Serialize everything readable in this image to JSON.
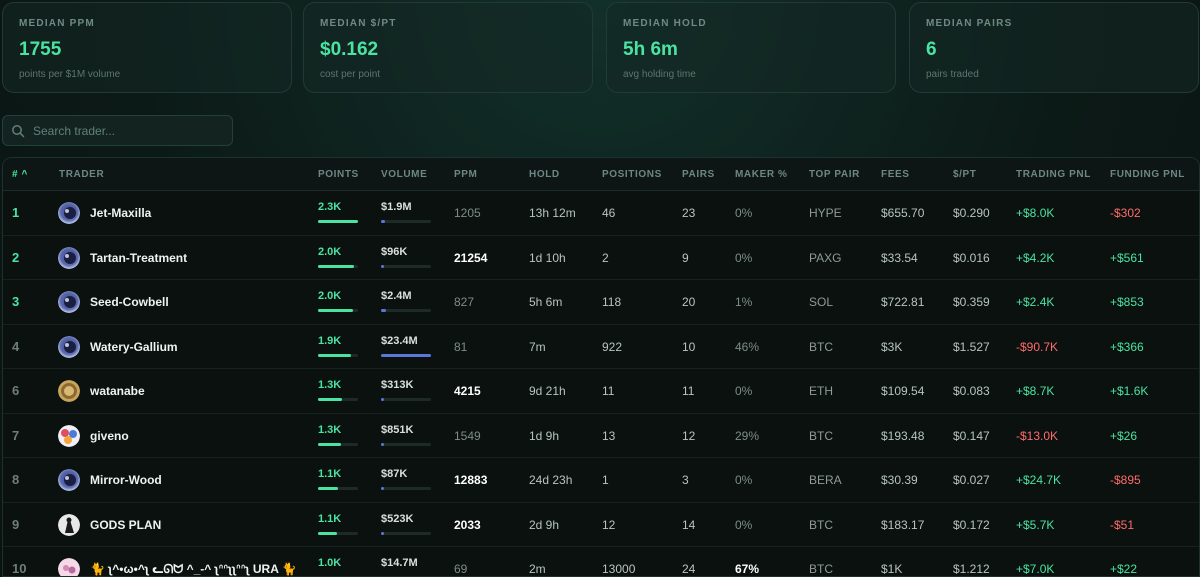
{
  "stats": [
    {
      "label": "MEDIAN PPM",
      "value": "1755",
      "sub": "points per $1M volume"
    },
    {
      "label": "MEDIAN $/PT",
      "value": "$0.162",
      "sub": "cost per point"
    },
    {
      "label": "MEDIAN HOLD",
      "value": "5h 6m",
      "sub": "avg holding time"
    },
    {
      "label": "MEDIAN PAIRS",
      "value": "6",
      "sub": "pairs traded"
    }
  ],
  "search": {
    "placeholder": "Search trader..."
  },
  "columns": {
    "rank": "# ^",
    "trader": "TRADER",
    "points": "POINTS",
    "volume": "VOLUME",
    "ppm": "PPM",
    "hold": "HOLD",
    "positions": "POSITIONS",
    "pairs": "PAIRS",
    "maker": "MAKER %",
    "top_pair": "TOP PAIR",
    "fees": "FEES",
    "per_pt": "$/PT",
    "trading_pnl": "TRADING PNL",
    "funding_pnl": "FUNDING PNL"
  },
  "colors": {
    "accent": "#4be3a2",
    "negative": "#ff6b6b",
    "volume_bar": "#5c78d6"
  },
  "rows": [
    {
      "rank": "1",
      "rank_dim": false,
      "avatar": "eclipse-avatar",
      "name": "Jet-Maxilla",
      "points": "2.3K",
      "points_fill": 1.0,
      "volume": "$1.9M",
      "volume_fill": 0.08,
      "ppm": "1205",
      "ppm_hi": false,
      "hold": "13h 12m",
      "positions": "46",
      "pairs": "23",
      "maker": "0%",
      "maker_hi": false,
      "top_pair": "HYPE",
      "fees": "$655.70",
      "per_pt": "$0.290",
      "trading_pnl": "+$8.0K",
      "trading_pos": true,
      "funding_pnl": "-$302",
      "funding_pos": false
    },
    {
      "rank": "2",
      "rank_dim": false,
      "avatar": "eclipse-avatar",
      "name": "Tartan-Treatment",
      "points": "2.0K",
      "points_fill": 0.9,
      "volume": "$96K",
      "volume_fill": 0.01,
      "ppm": "21254",
      "ppm_hi": true,
      "hold": "1d 10h",
      "positions": "2",
      "pairs": "9",
      "maker": "0%",
      "maker_hi": false,
      "top_pair": "PAXG",
      "fees": "$33.54",
      "per_pt": "$0.016",
      "trading_pnl": "+$4.2K",
      "trading_pos": true,
      "funding_pnl": "+$561",
      "funding_pos": true
    },
    {
      "rank": "3",
      "rank_dim": false,
      "avatar": "eclipse-avatar",
      "name": "Seed-Cowbell",
      "points": "2.0K",
      "points_fill": 0.88,
      "volume": "$2.4M",
      "volume_fill": 0.1,
      "ppm": "827",
      "ppm_hi": false,
      "hold": "5h 6m",
      "positions": "118",
      "pairs": "20",
      "maker": "1%",
      "maker_hi": false,
      "top_pair": "SOL",
      "fees": "$722.81",
      "per_pt": "$0.359",
      "trading_pnl": "+$2.4K",
      "trading_pos": true,
      "funding_pnl": "+$853",
      "funding_pos": true
    },
    {
      "rank": "4",
      "rank_dim": true,
      "avatar": "eclipse-avatar",
      "name": "Watery-Gallium",
      "points": "1.9K",
      "points_fill": 0.82,
      "volume": "$23.4M",
      "volume_fill": 1.0,
      "ppm": "81",
      "ppm_hi": false,
      "hold": "7m",
      "positions": "922",
      "pairs": "10",
      "maker": "46%",
      "maker_hi": false,
      "top_pair": "BTC",
      "fees": "$3K",
      "per_pt": "$1.527",
      "trading_pnl": "-$90.7K",
      "trading_pos": false,
      "funding_pnl": "+$366",
      "funding_pos": true
    },
    {
      "rank": "6",
      "rank_dim": true,
      "avatar": "coin-avatar",
      "name": "watanabe",
      "points": "1.3K",
      "points_fill": 0.6,
      "volume": "$313K",
      "volume_fill": 0.02,
      "ppm": "4215",
      "ppm_hi": true,
      "hold": "9d 21h",
      "positions": "11",
      "pairs": "11",
      "maker": "0%",
      "maker_hi": false,
      "top_pair": "ETH",
      "fees": "$109.54",
      "per_pt": "$0.083",
      "trading_pnl": "+$8.7K",
      "trading_pos": true,
      "funding_pnl": "+$1.6K",
      "funding_pos": true
    },
    {
      "rank": "7",
      "rank_dim": true,
      "avatar": "colorful-avatar",
      "name": "giveno",
      "points": "1.3K",
      "points_fill": 0.57,
      "volume": "$851K",
      "volume_fill": 0.04,
      "ppm": "1549",
      "ppm_hi": false,
      "hold": "1d 9h",
      "positions": "13",
      "pairs": "12",
      "maker": "29%",
      "maker_hi": false,
      "top_pair": "BTC",
      "fees": "$193.48",
      "per_pt": "$0.147",
      "trading_pnl": "-$13.0K",
      "trading_pos": false,
      "funding_pnl": "+$26",
      "funding_pos": true
    },
    {
      "rank": "8",
      "rank_dim": true,
      "avatar": "eclipse-avatar",
      "name": "Mirror-Wood",
      "points": "1.1K",
      "points_fill": 0.5,
      "volume": "$87K",
      "volume_fill": 0.01,
      "ppm": "12883",
      "ppm_hi": true,
      "hold": "24d 23h",
      "positions": "1",
      "pairs": "3",
      "maker": "0%",
      "maker_hi": false,
      "top_pair": "BERA",
      "fees": "$30.39",
      "per_pt": "$0.027",
      "trading_pnl": "+$24.7K",
      "trading_pos": true,
      "funding_pnl": "-$895",
      "funding_pos": false
    },
    {
      "rank": "9",
      "rank_dim": true,
      "avatar": "dark-figure-avatar",
      "name": "GODS PLAN",
      "points": "1.1K",
      "points_fill": 0.48,
      "volume": "$523K",
      "volume_fill": 0.03,
      "ppm": "2033",
      "ppm_hi": true,
      "hold": "2d 9h",
      "positions": "12",
      "pairs": "14",
      "maker": "0%",
      "maker_hi": false,
      "top_pair": "BTC",
      "fees": "$183.17",
      "per_pt": "$0.172",
      "trading_pnl": "+$5.7K",
      "trading_pos": true,
      "funding_pnl": "-$51",
      "funding_pos": false
    },
    {
      "rank": "10",
      "rank_dim": true,
      "avatar": "pink-avatar",
      "name": "🐈 ʅ^•ω•^ʅ ᓚᘏᗢ ^_-^ ʅᐢᐢʅʅᐢᐢʅ URA 🐈",
      "points": "1.0K",
      "points_fill": 0.45,
      "volume": "$14.7M",
      "volume_fill": 0.63,
      "ppm": "69",
      "ppm_hi": false,
      "hold": "2m",
      "positions": "13000",
      "pairs": "24",
      "maker": "67%",
      "maker_hi": true,
      "top_pair": "BTC",
      "fees": "$1K",
      "per_pt": "$1.212",
      "trading_pnl": "+$7.0K",
      "trading_pos": true,
      "funding_pnl": "+$22",
      "funding_pos": true
    }
  ]
}
